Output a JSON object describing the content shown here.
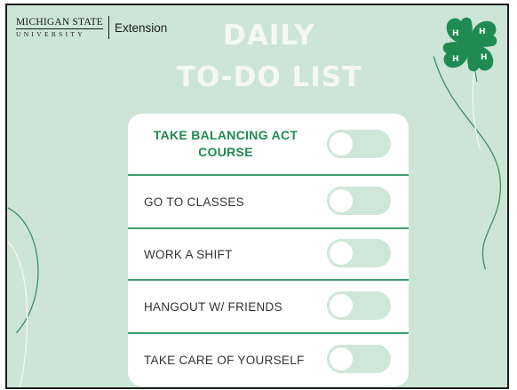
{
  "header": {
    "logo_line1": "MICHIGAN STATE",
    "logo_line2": "UNIVERSITY",
    "logo_extension": "Extension",
    "title_line1": "DAILY",
    "title_line2": "TO-DO LIST",
    "emblem_icon": "four-h-clover-icon"
  },
  "todo": {
    "items": [
      {
        "label": "TAKE BALANCING ACT COURSE",
        "checked": false,
        "featured": true
      },
      {
        "label": "GO TO CLASSES",
        "checked": false,
        "featured": false
      },
      {
        "label": "WORK A SHIFT",
        "checked": false,
        "featured": false
      },
      {
        "label": "HANGOUT W/ FRIENDS",
        "checked": false,
        "featured": false
      },
      {
        "label": "TAKE CARE OF YOURSELF",
        "checked": false,
        "featured": false
      }
    ]
  },
  "colors": {
    "background": "#cde5d6",
    "accent": "#1f8a52",
    "toggle_track": "#cfe7d9",
    "card": "#ffffff"
  }
}
